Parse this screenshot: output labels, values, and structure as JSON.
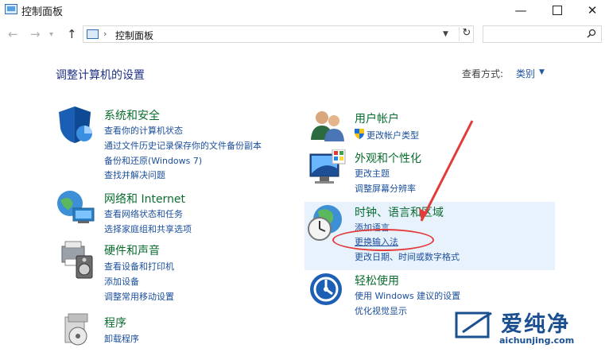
{
  "window": {
    "title": "控制面板",
    "minimize": "—",
    "close": "✕"
  },
  "address": {
    "path": "控制面板",
    "separator": "›",
    "search_placeholder": ""
  },
  "header": {
    "title": "调整计算机的设置",
    "view_by_label": "查看方式:",
    "view_by_value": "类别"
  },
  "categories": {
    "system": {
      "title": "系统和安全",
      "links": [
        "查看你的计算机状态",
        "通过文件历史记录保存你的文件备份副本",
        "备份和还原(Windows 7)",
        "查找并解决问题"
      ]
    },
    "network": {
      "title": "网络和 Internet",
      "links": [
        "查看网络状态和任务",
        "选择家庭组和共享选项"
      ]
    },
    "hardware": {
      "title": "硬件和声音",
      "links": [
        "查看设备和打印机",
        "添加设备",
        "调整常用移动设置"
      ]
    },
    "programs": {
      "title": "程序",
      "links": [
        "卸载程序"
      ]
    },
    "accounts": {
      "title": "用户帐户",
      "links": [
        "更改帐户类型"
      ]
    },
    "appearance": {
      "title": "外观和个性化",
      "links": [
        "更改主题",
        "调整屏幕分辨率"
      ]
    },
    "clock": {
      "title": "时钟、语言和区域",
      "links": [
        "添加语言",
        "更换输入法",
        "更改日期、时间或数字格式"
      ]
    },
    "ease": {
      "title": "轻松使用",
      "links": [
        "使用 Windows 建议的设置",
        "优化视觉显示"
      ]
    }
  },
  "watermark": {
    "text": "爱纯净",
    "url": "aichunjing.com"
  },
  "colors": {
    "category_title": "#0a6d2f",
    "link": "#1b4f9c",
    "heading": "#1e3287",
    "annotation": "#e43a3a",
    "highlight": "#e8f2fc"
  }
}
